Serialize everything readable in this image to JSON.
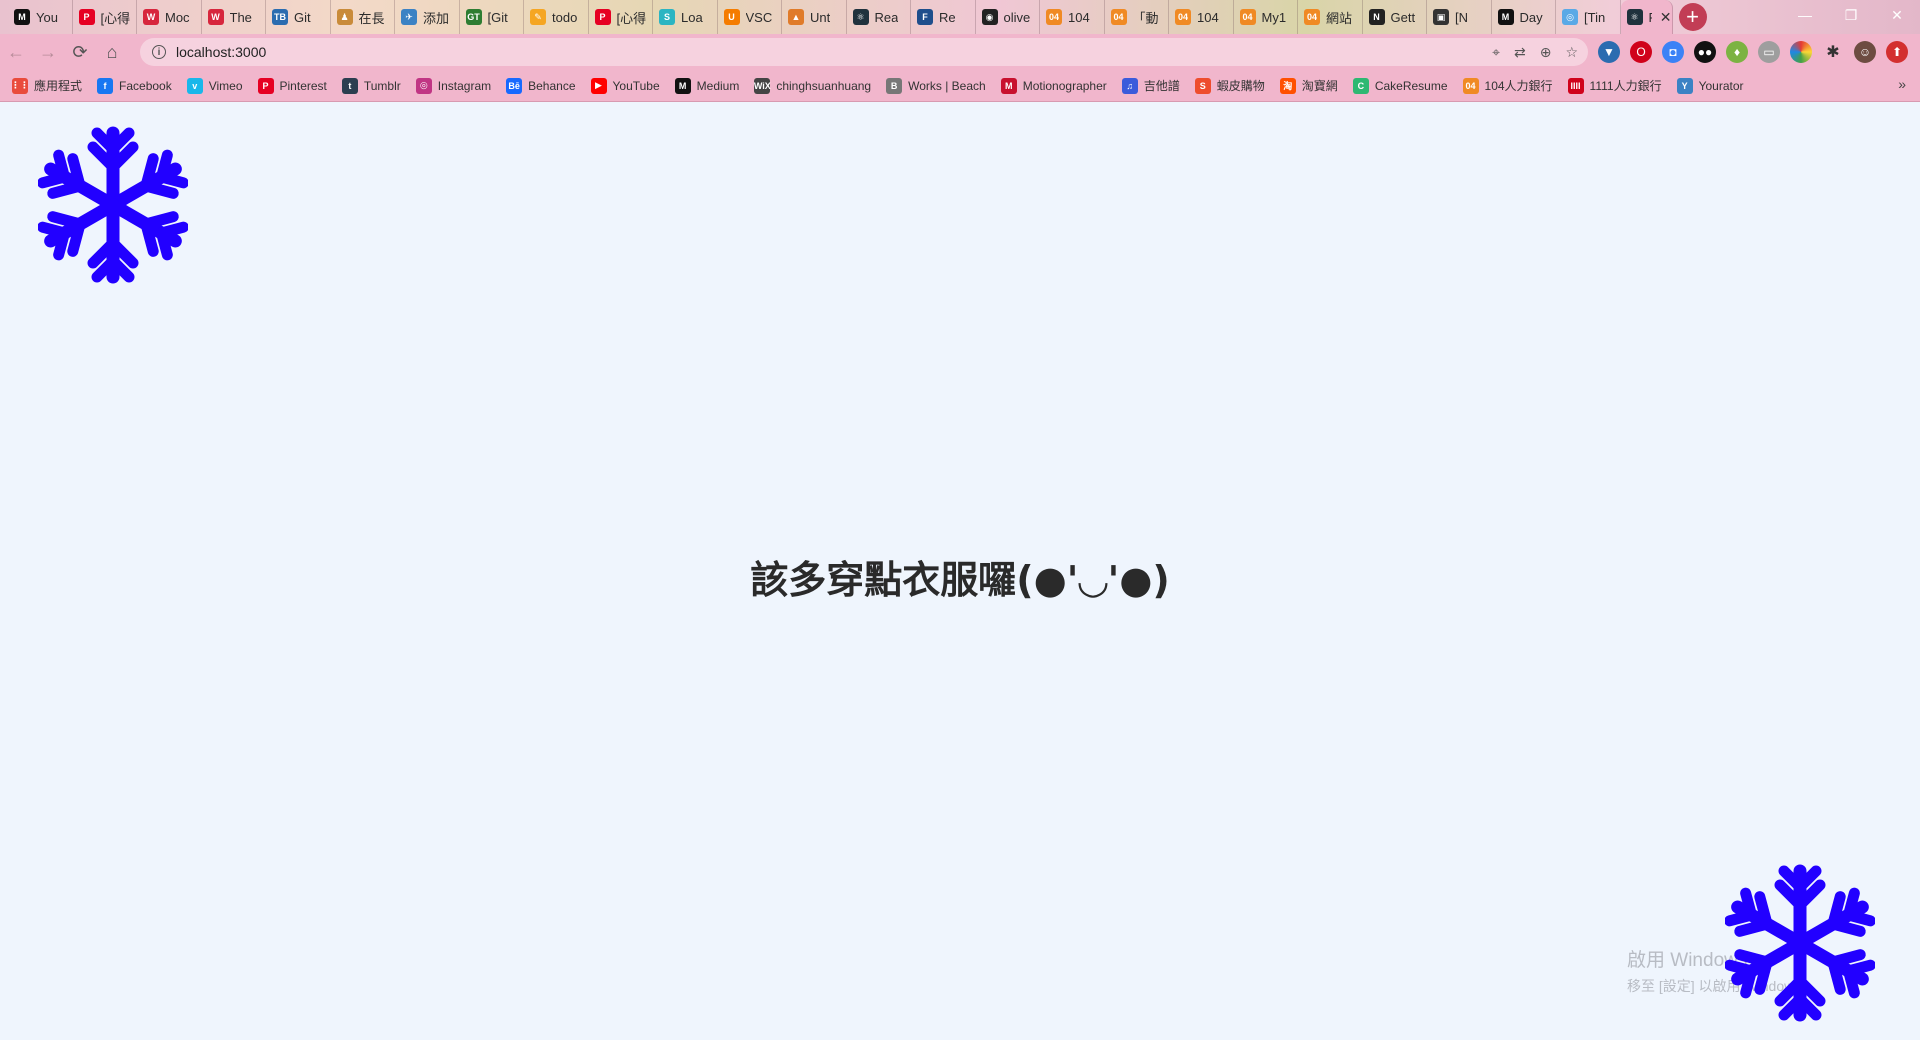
{
  "browser": {
    "tabs": [
      {
        "title": "You",
        "fav": "M",
        "color": "#111111"
      },
      {
        "title": "[心得",
        "fav": "P",
        "color": "#e60023"
      },
      {
        "title": "Moc",
        "fav": "W",
        "color": "#d7263d"
      },
      {
        "title": "The",
        "fav": "W",
        "color": "#d7263d"
      },
      {
        "title": "Git",
        "fav": "TB",
        "color": "#2b6cb0"
      },
      {
        "title": "在長",
        "fav": "♟",
        "color": "#c98b3a"
      },
      {
        "title": "添加",
        "fav": "✈",
        "color": "#3b82c4"
      },
      {
        "title": "[Git",
        "fav": "GT",
        "color": "#2e7d32"
      },
      {
        "title": "todo",
        "fav": "✎",
        "color": "#f5a623"
      },
      {
        "title": "[心得",
        "fav": "P",
        "color": "#e60023"
      },
      {
        "title": "Loa",
        "fav": "S",
        "color": "#2bb5c2"
      },
      {
        "title": "VSC",
        "fav": "U",
        "color": "#f57c00"
      },
      {
        "title": "Unt",
        "fav": "▲",
        "color": "#e07b2a"
      },
      {
        "title": "Rea",
        "fav": "⚛",
        "color": "#20323d"
      },
      {
        "title": "Re",
        "fav": "F",
        "color": "#1f4e8c"
      },
      {
        "title": "olive",
        "fav": "◉",
        "color": "#222222"
      },
      {
        "title": "104",
        "fav": "04",
        "color": "#f08a24"
      },
      {
        "title": "「動",
        "fav": "04",
        "color": "#f08a24"
      },
      {
        "title": "104",
        "fav": "04",
        "color": "#f08a24"
      },
      {
        "title": "My1",
        "fav": "04",
        "color": "#f08a24"
      },
      {
        "title": "網站",
        "fav": "04",
        "color": "#f08a24"
      },
      {
        "title": "Gett",
        "fav": "N",
        "color": "#222222"
      },
      {
        "title": "[N",
        "fav": "▣",
        "color": "#333333"
      },
      {
        "title": "Day",
        "fav": "M",
        "color": "#111111"
      },
      {
        "title": "[Tin",
        "fav": "◎",
        "color": "#5aa9e6"
      },
      {
        "title": "F",
        "fav": "⚛",
        "color": "#20323d",
        "active": true
      }
    ],
    "new_tab_symbol": "+",
    "window_controls": {
      "minimize": "—",
      "restore": "❐",
      "close": "✕"
    },
    "nav": {
      "back": "←",
      "forward": "→",
      "reload": "⟳",
      "home": "⌂"
    },
    "url": "localhost:3000",
    "bookmarks": [
      {
        "label": "應用程式",
        "fav": "⋮⋮",
        "color": "#e94b3c"
      },
      {
        "label": "Facebook",
        "fav": "f",
        "color": "#1877f2"
      },
      {
        "label": "Vimeo",
        "fav": "v",
        "color": "#19b7ea"
      },
      {
        "label": "Pinterest",
        "fav": "P",
        "color": "#e60023"
      },
      {
        "label": "Tumblr",
        "fav": "t",
        "color": "#2c3e50"
      },
      {
        "label": "Instagram",
        "fav": "◎",
        "color": "#c13584"
      },
      {
        "label": "Behance",
        "fav": "Bē",
        "color": "#1769ff"
      },
      {
        "label": "YouTube",
        "fav": "▶",
        "color": "#ff0000"
      },
      {
        "label": "Medium",
        "fav": "M",
        "color": "#111111"
      },
      {
        "label": "chinghsuanhuang",
        "fav": "WiX",
        "color": "#444444"
      },
      {
        "label": "Works | Beach",
        "fav": "B",
        "color": "#777777"
      },
      {
        "label": "Motionographer",
        "fav": "M",
        "color": "#c8102e"
      },
      {
        "label": "吉他譜",
        "fav": "♫",
        "color": "#3b5bdb"
      },
      {
        "label": "蝦皮購物",
        "fav": "S",
        "color": "#ee4d2d"
      },
      {
        "label": "淘寶網",
        "fav": "淘",
        "color": "#ff5000"
      },
      {
        "label": "CakeResume",
        "fav": "C",
        "color": "#2eb872"
      },
      {
        "label": "104人力銀行",
        "fav": "04",
        "color": "#f08a24"
      },
      {
        "label": "1111人力銀行",
        "fav": "IIII",
        "color": "#d0021b"
      },
      {
        "label": "Yourator",
        "fav": "Y",
        "color": "#3b82c4"
      }
    ],
    "bookmarks_more": "»"
  },
  "page": {
    "message": "該多穿點衣服囉(●'◡'●)",
    "snowflake_color": "#2200ff"
  },
  "os_watermark": {
    "line1": "啟用 Windows",
    "line2": "移至 [設定] 以啟用 Windows。"
  }
}
